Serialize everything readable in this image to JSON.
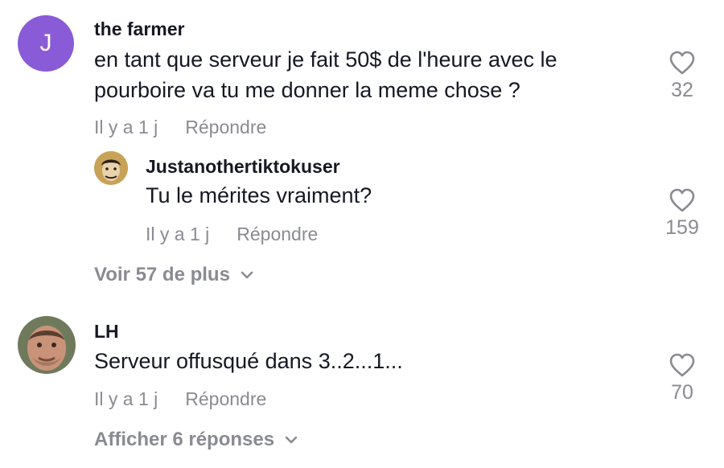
{
  "comments": [
    {
      "username": "the farmer",
      "avatar_letter": "J",
      "text_lines": [
        "en tant que serveur je fait 50$ de l'heure avec le",
        "pourboire va tu me donner la meme chose ?"
      ],
      "time": "Il y a 1 j",
      "reply_label": "Répondre",
      "likes": "32"
    },
    {
      "username": "Justanothertiktokuser",
      "text_lines": [
        "Tu le mérites vraiment?"
      ],
      "time": "Il y a 1 j",
      "reply_label": "Répondre",
      "likes": "159"
    },
    {
      "username": "LH",
      "text_lines": [
        "Serveur offusqué dans 3..2...1..."
      ],
      "time": "Il y a 1 j",
      "reply_label": "Répondre",
      "likes": "70"
    }
  ],
  "view_more_1": "Voir 57 de plus",
  "view_more_2": "Afficher 6 réponses",
  "colors": {
    "avatar_purple": "#8a5bd6",
    "muted_text": "#8a8b91",
    "main_text": "#161823"
  },
  "icons": {
    "like": "heart-outline-icon",
    "expand": "chevron-down-icon"
  }
}
